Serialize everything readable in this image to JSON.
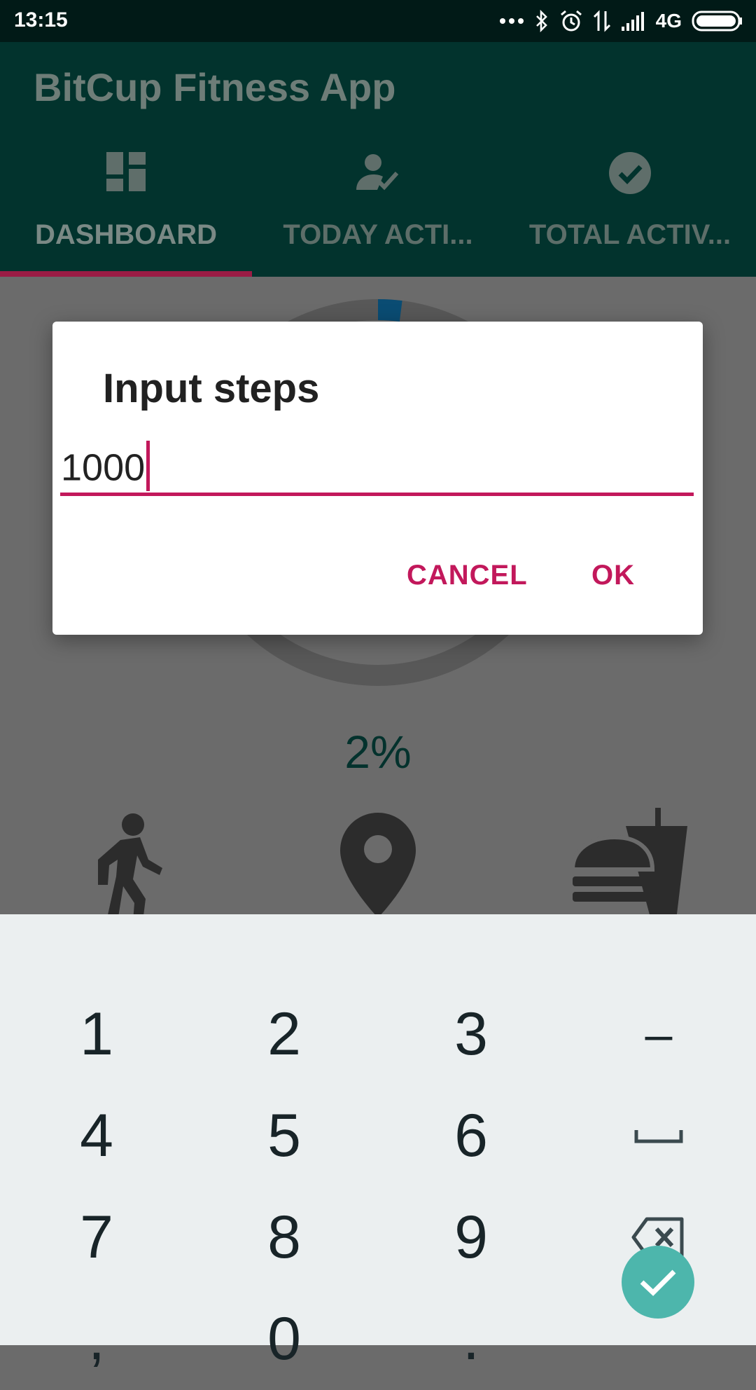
{
  "status_bar": {
    "time": "13:15",
    "network": "4G"
  },
  "app": {
    "title": "BitCup Fitness App"
  },
  "tabs": [
    {
      "label": "DASHBOARD",
      "icon": "dashboard-icon",
      "active": true
    },
    {
      "label": "TODAY ACTI...",
      "icon": "person-check-icon",
      "active": false
    },
    {
      "label": "TOTAL ACTIV...",
      "icon": "check-circle-icon",
      "active": false
    }
  ],
  "dashboard": {
    "progress_percent_text": "2%",
    "progress_fraction": 0.02,
    "icons": [
      "walk-icon",
      "location-pin-icon",
      "fast-food-icon"
    ]
  },
  "dialog": {
    "title": "Input steps",
    "input_value": "1000",
    "cancel_label": "CANCEL",
    "ok_label": "OK",
    "accent_color": "#c2185b"
  },
  "keyboard": {
    "keys": [
      "1",
      "2",
      "3",
      "–",
      "4",
      "5",
      "6",
      "␣",
      "7",
      "8",
      "9",
      "⌫",
      ",",
      "0",
      "."
    ],
    "row1": [
      "1",
      "2",
      "3",
      "–"
    ],
    "row2": [
      "4",
      "5",
      "6"
    ],
    "row3": [
      "7",
      "8",
      "9"
    ],
    "row4": [
      ",",
      "0",
      "."
    ],
    "enter_icon": "check-icon"
  },
  "colors": {
    "app_bar": "#02332d",
    "status_bar": "#011a17",
    "scrim": "#6b6b6b",
    "enter_key": "#4db6ac",
    "ring_progress": "#0a4c73"
  }
}
